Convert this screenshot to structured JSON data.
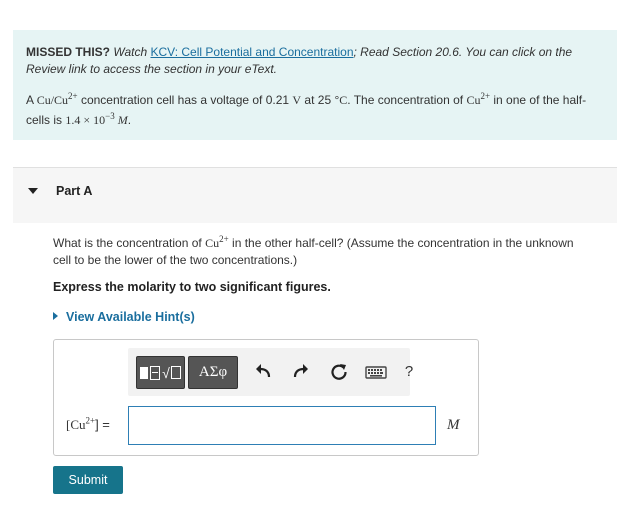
{
  "intro": {
    "missed_label": "MISSED THIS?",
    "watch_text": " Watch ",
    "video_link": "KCV: Cell Potential and Concentration",
    "after_link": "; Read Section 20.6. You can click on the Review link to access the section in your eText.",
    "problem_1": "A ",
    "cell_pair": "Cu/Cu",
    "charge": "2+",
    "problem_2": " concentration cell has a voltage of 0.21 ",
    "volt_unit": "V",
    "problem_3": " at 25 °",
    "celsius": "C",
    "problem_4": ". The concentration of ",
    "cu_ion": "Cu",
    "problem_5": " in one of the half-cells is ",
    "conc_value": "1.4 × 10",
    "conc_exp": "−3",
    "conc_unit": "M",
    "period": "."
  },
  "part": {
    "title": "Part A"
  },
  "question": {
    "text_1": "What is the concentration of ",
    "cu_ion": "Cu",
    "charge": "2+",
    "text_2": " in the other half-cell? (Assume the concentration in the unknown cell to be the lower of the two concentrations.)",
    "instruction": "Express the molarity to two significant figures.",
    "hint_link": "View Available Hint(s)"
  },
  "toolbar": {
    "templates_icon": "templates-icon",
    "greek_label": "AΣφ",
    "undo_icon": "undo-icon",
    "redo_icon": "redo-icon",
    "reset_icon": "reset-icon",
    "keyboard_icon": "keyboard-icon",
    "help_label": "?"
  },
  "answer": {
    "label_open": "[Cu",
    "label_charge": "2+",
    "label_close": "] =",
    "value": "",
    "unit": "M"
  },
  "submit_label": "Submit",
  "colors": {
    "intro_bg": "#e6f4f4",
    "link": "#1a6e9e",
    "submit_bg": "#16748b",
    "input_border": "#2e7fb5"
  }
}
